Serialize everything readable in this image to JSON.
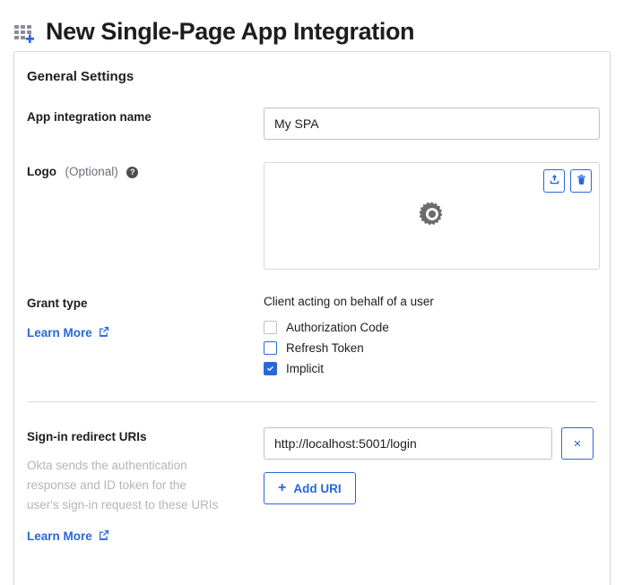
{
  "header": {
    "title": "New Single-Page App Integration",
    "icon": "app-grid-plus-icon"
  },
  "card": {
    "section_title": "General Settings",
    "app_name": {
      "label": "App integration name",
      "value": "My SPA",
      "placeholder": ""
    },
    "logo": {
      "label": "Logo",
      "optional_text": "(Optional)",
      "help_glyph": "?",
      "upload_icon": "upload-icon",
      "delete_icon": "trash-icon",
      "placeholder_icon": "gear-icon"
    },
    "grant_type": {
      "label": "Grant type",
      "caption": "Client acting on behalf of a user",
      "learn_more": "Learn More",
      "options": [
        {
          "label": "Authorization Code",
          "checked": false,
          "disabled": true
        },
        {
          "label": "Refresh Token",
          "checked": false,
          "disabled": false
        },
        {
          "label": "Implicit",
          "checked": true,
          "disabled": false
        }
      ]
    },
    "redirect_uris": {
      "label": "Sign-in redirect URIs",
      "helper_text": "Okta sends the authentication response and ID token for the user's sign-in request to these URIs",
      "learn_more": "Learn More",
      "uris": [
        {
          "value": "http://localhost:5001/login",
          "remove_glyph": "×"
        }
      ],
      "add_button": {
        "plus": "+",
        "label": "Add URI"
      }
    }
  },
  "colors": {
    "accent_blue": "#2968d8",
    "text_dark": "#1d1d21",
    "text_muted": "#6e6e78",
    "helper_gray": "#b4b4bc",
    "border_gray": "#d7d7dc",
    "input_border": "#c1c1c9",
    "icon_gray": "#6b6b6b"
  }
}
